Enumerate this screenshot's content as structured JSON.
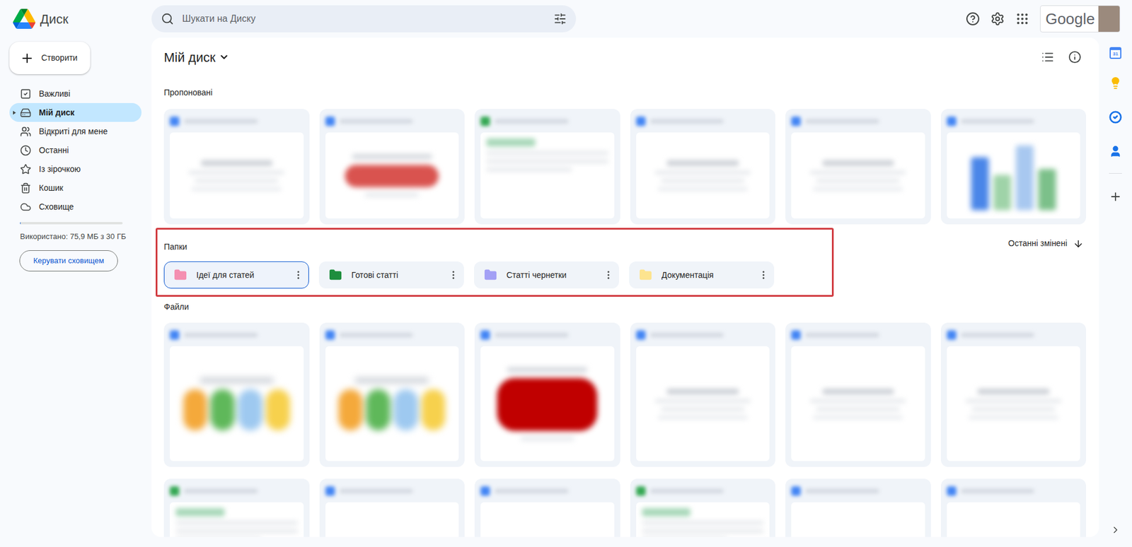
{
  "app": {
    "title": "Диск",
    "create_button": "Створити"
  },
  "search": {
    "placeholder": "Шукати на Диску"
  },
  "account": {
    "label": "Google"
  },
  "sidebar": {
    "items": [
      {
        "label": "Важливі",
        "selected": false
      },
      {
        "label": "Мій диск",
        "selected": true
      },
      {
        "label": "Відкриті для мене",
        "selected": false
      },
      {
        "label": "Останні",
        "selected": false
      },
      {
        "label": "Із зірочкою",
        "selected": false
      },
      {
        "label": "Кошик",
        "selected": false
      },
      {
        "label": "Сховище",
        "selected": false
      }
    ],
    "storage": {
      "text": "Використано: 75,9 МБ з 30 ГБ",
      "level": 0.0025,
      "button": "Керувати сховищем"
    }
  },
  "main": {
    "title": "Мій диск"
  },
  "suggested": {
    "label": "Пропоновані",
    "cards": [
      {
        "kind": "doc"
      },
      {
        "kind": "red-banner"
      },
      {
        "kind": "sheet"
      },
      {
        "kind": "doc"
      },
      {
        "kind": "doc"
      },
      {
        "kind": "chart"
      }
    ]
  },
  "folders": {
    "label": "Папки",
    "sort": "Останні змінені",
    "items": [
      {
        "name": "Ідеї для статей",
        "color": "#f48fb1",
        "selected": true
      },
      {
        "name": "Готові статті",
        "color": "#1e8e3e",
        "selected": false
      },
      {
        "name": "Статті чернетки",
        "color": "#a3a0f5",
        "selected": false
      },
      {
        "name": "Документація",
        "color": "#fde48f",
        "selected": false
      }
    ]
  },
  "files": {
    "label": "Файли",
    "cards": [
      {
        "kind": "photo"
      },
      {
        "kind": "photo"
      },
      {
        "kind": "red-banner"
      },
      {
        "kind": "doc"
      },
      {
        "kind": "doc"
      },
      {
        "kind": "doc"
      },
      {
        "kind": "sheet"
      },
      {
        "kind": "doc"
      },
      {
        "kind": "doc"
      },
      {
        "kind": "sheet"
      },
      {
        "kind": "doc"
      },
      {
        "kind": "doc"
      }
    ]
  },
  "side_apps": {
    "calendar_day": "31"
  }
}
